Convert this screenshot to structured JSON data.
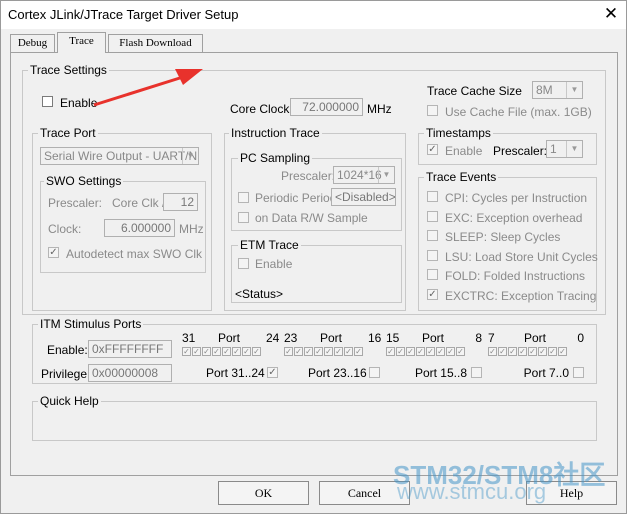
{
  "window": {
    "title": "Cortex JLink/JTrace Target Driver Setup",
    "close_glyph": "✕"
  },
  "tabs": [
    {
      "label": "Debug"
    },
    {
      "label": "Trace"
    },
    {
      "label": "Flash Download"
    }
  ],
  "trace_settings": {
    "group_label": "Trace Settings",
    "enable_label": "Enable",
    "core_clock_label": "Core Clock:",
    "core_clock_value": "72.000000",
    "core_clock_unit": "MHz",
    "cache_size_label": "Trace Cache Size",
    "cache_size_value": "8M",
    "use_cache_file_label": "Use Cache File (max. 1GB)"
  },
  "trace_port": {
    "group_label": "Trace Port",
    "value": "Serial Wire Output - UART/N",
    "swo": {
      "group_label": "SWO Settings",
      "prescaler_label": "Prescaler:",
      "core_clk_label": "Core Clk /",
      "prescaler_value": "12",
      "clock_label": "Clock:",
      "clock_value": "6.000000",
      "clock_unit": "MHz",
      "autodetect_label": "Autodetect max SWO Clk"
    }
  },
  "instruction_trace": {
    "group_label": "Instruction Trace",
    "pc_sampling": {
      "group_label": "PC Sampling",
      "prescaler_label": "Prescaler:",
      "prescaler_value": "1024*16",
      "periodic_label": "Periodic  Period:",
      "period_value": "<Disabled>",
      "rw_label": "on Data R/W Sample"
    },
    "etm": {
      "group_label": "ETM Trace",
      "enable_label": "Enable",
      "status": "<Status>"
    }
  },
  "timestamps": {
    "group_label": "Timestamps",
    "enable_label": "Enable",
    "prescaler_label": "Prescaler:",
    "prescaler_value": "1"
  },
  "trace_events": {
    "group_label": "Trace Events",
    "items": [
      {
        "label": "CPI: Cycles per Instruction",
        "checked": false
      },
      {
        "label": "EXC: Exception overhead",
        "checked": false
      },
      {
        "label": "SLEEP: Sleep Cycles",
        "checked": false
      },
      {
        "label": "LSU: Load Store Unit Cycles",
        "checked": false
      },
      {
        "label": "FOLD: Folded Instructions",
        "checked": false
      },
      {
        "label": "EXCTRC: Exception Tracing",
        "checked": true
      }
    ]
  },
  "itm": {
    "group_label": "ITM Stimulus Ports",
    "enable_label": "Enable:",
    "enable_value": "0xFFFFFFFF",
    "privilege_label": "Privilege:",
    "privilege_value": "0x00000008",
    "port_word": "Port",
    "ranges": [
      {
        "hi": "31",
        "lo": "24",
        "port_label": "Port 31..24"
      },
      {
        "hi": "23",
        "lo": "16",
        "port_label": "Port 23..16"
      },
      {
        "hi": "15",
        "lo": "8",
        "port_label": "Port 15..8"
      },
      {
        "hi": "7",
        "lo": "0",
        "port_label": "Port 7..0"
      }
    ]
  },
  "quick_help": {
    "group_label": "Quick Help"
  },
  "buttons": {
    "ok": "OK",
    "cancel": "Cancel",
    "help": "Help"
  },
  "watermark": {
    "line1": "STM32/STM8社区",
    "line2": "www.stmcu.org"
  },
  "colors": {
    "arrow": "#e8322c",
    "watermark": "#4696c8"
  }
}
